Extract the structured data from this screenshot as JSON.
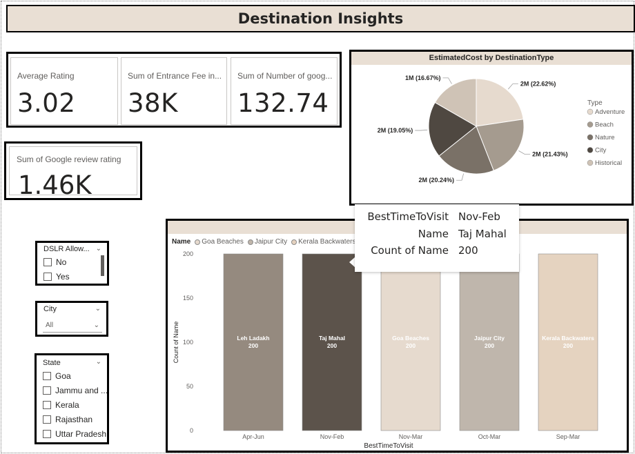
{
  "page": {
    "title": "Destination Insights"
  },
  "kpis": [
    {
      "label": "Average Rating",
      "value": "3.02"
    },
    {
      "label": "Sum of Entrance Fee in...",
      "value": "38K"
    },
    {
      "label": "Sum of Number of goog...",
      "value": "132.74"
    }
  ],
  "kpi_single": {
    "label": "Sum of Google review rating",
    "value": "1.46K"
  },
  "pie_chart": {
    "title": "EstimatedCost by DestinationType",
    "legend_title": "Type",
    "slices": [
      {
        "name": "Adventure",
        "label": "2M (22.62%)",
        "percent": 22.62,
        "color": "#e6dace"
      },
      {
        "name": "Beach",
        "label": "2M (21.43%)",
        "percent": 21.43,
        "color": "#a59b8f"
      },
      {
        "name": "Nature",
        "label": "2M (20.24%)",
        "percent": 20.24,
        "color": "#7a7167"
      },
      {
        "name": "City",
        "label": "2M (19.05%)",
        "percent": 19.05,
        "color": "#4f4841"
      },
      {
        "name": "Historical",
        "label": "1M (16.67%)",
        "percent": 16.67,
        "color": "#cfc3b6"
      }
    ]
  },
  "slicers": {
    "dslr": {
      "title": "DSLR Allow...",
      "options": [
        "No",
        "Yes"
      ]
    },
    "city": {
      "title": "City",
      "selected": "All"
    },
    "state": {
      "title": "State",
      "options": [
        "Goa",
        "Jammu and ...",
        "Kerala",
        "Rajasthan",
        "Uttar Pradesh"
      ]
    }
  },
  "bar_chart": {
    "title": "Count of Destiantion",
    "legend_title": "Name",
    "legend_items": [
      {
        "name": "Goa Beaches",
        "color": "#e6dace"
      },
      {
        "name": "Jaipur City",
        "color": "#c0b6ab"
      },
      {
        "name": "Kerala Backwaters",
        "color": "#e5d2bf"
      },
      {
        "name": "Le",
        "color": "#8e8479"
      }
    ]
  },
  "chart_data": {
    "type": "bar",
    "title": "Count of Destiantion",
    "xlabel": "BestTimeToVisit",
    "ylabel": "Count of Name",
    "categories": [
      "Apr-Jun",
      "Nov-Feb",
      "Nov-Mar",
      "Oct-Mar",
      "Sep-Mar"
    ],
    "series": [
      {
        "name": "Leh Ladakh",
        "values": [
          200,
          0,
          0,
          0,
          0
        ]
      },
      {
        "name": "Taj Mahal",
        "values": [
          0,
          200,
          0,
          0,
          0
        ]
      },
      {
        "name": "Goa Beaches",
        "values": [
          0,
          0,
          200,
          0,
          0
        ]
      },
      {
        "name": "Jaipur City",
        "values": [
          0,
          0,
          0,
          200,
          0
        ]
      },
      {
        "name": "Kerala Backwaters",
        "values": [
          0,
          0,
          0,
          0,
          200
        ]
      }
    ],
    "bars": [
      {
        "category": "Apr-Jun",
        "name": "Leh Ladakh",
        "value": 200,
        "color": "#958a7f",
        "text_color": "#ffffff"
      },
      {
        "category": "Nov-Feb",
        "name": "Taj Mahal",
        "value": 200,
        "color": "#5c534b",
        "text_color": "#ffffff"
      },
      {
        "category": "Nov-Mar",
        "name": "Goa Beaches",
        "value": 200,
        "color": "#e6dace",
        "text_color": "#ffffff"
      },
      {
        "category": "Oct-Mar",
        "name": "Jaipur City",
        "value": 200,
        "color": "#bfb6ac",
        "text_color": "#ffffff"
      },
      {
        "category": "Sep-Mar",
        "name": "Kerala Backwaters",
        "value": 200,
        "color": "#e5d3c0",
        "text_color": "#ffffff"
      }
    ],
    "yticks": [
      0,
      50,
      100,
      150,
      200
    ],
    "ylim": [
      0,
      200
    ],
    "grid": false
  },
  "tooltip": {
    "rows": [
      {
        "key": "BestTimeToVisit",
        "value": "Nov-Feb"
      },
      {
        "key": "Name",
        "value": "Taj Mahal"
      },
      {
        "key": "Count of Name",
        "value": "200"
      }
    ]
  }
}
